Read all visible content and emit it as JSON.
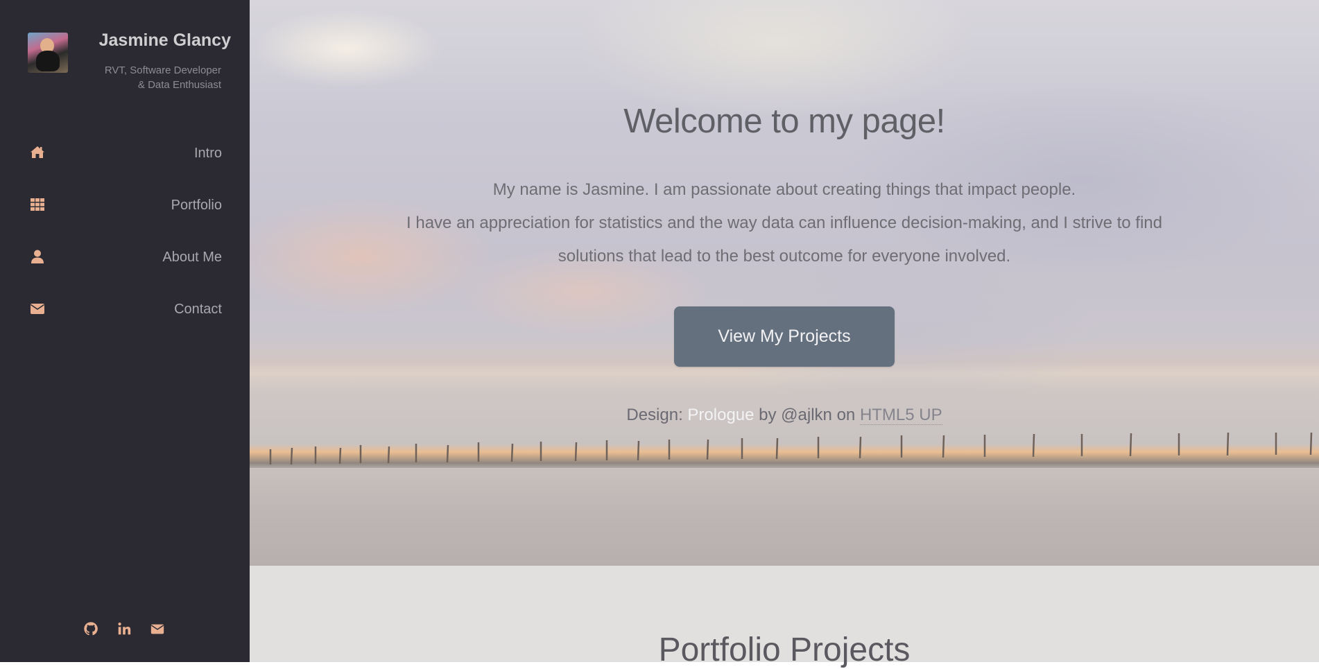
{
  "sidebar": {
    "name": "Jasmine Glancy",
    "tagline_line1": "RVT, Software Developer",
    "tagline_line2": "& Data Enthusiast",
    "nav": [
      {
        "label": "Intro",
        "icon": "home-icon"
      },
      {
        "label": "Portfolio",
        "icon": "grid-icon"
      },
      {
        "label": "About Me",
        "icon": "user-icon"
      },
      {
        "label": "Contact",
        "icon": "envelope-icon"
      }
    ],
    "social": [
      "github-icon",
      "linkedin-icon",
      "envelope-icon"
    ]
  },
  "hero": {
    "title": "Welcome to my page!",
    "line1": "My name is Jasmine. I am passionate about creating things that impact people.",
    "line2": "I have an appreciation for statistics and the way data can influence decision-making, and I strive to find",
    "line3": "solutions that lead to the best outcome for everyone involved.",
    "cta_label": "View My Projects",
    "credit_prefix": "Design: ",
    "credit_link1": "Prologue",
    "credit_middle": " by @ajlkn on ",
    "credit_link2": "HTML5 UP"
  },
  "portfolio": {
    "title": "Portfolio Projects"
  },
  "colors": {
    "sidebar_bg": "#2b2a32",
    "icon_accent": "#e8b091",
    "button_bg": "#65707e"
  }
}
